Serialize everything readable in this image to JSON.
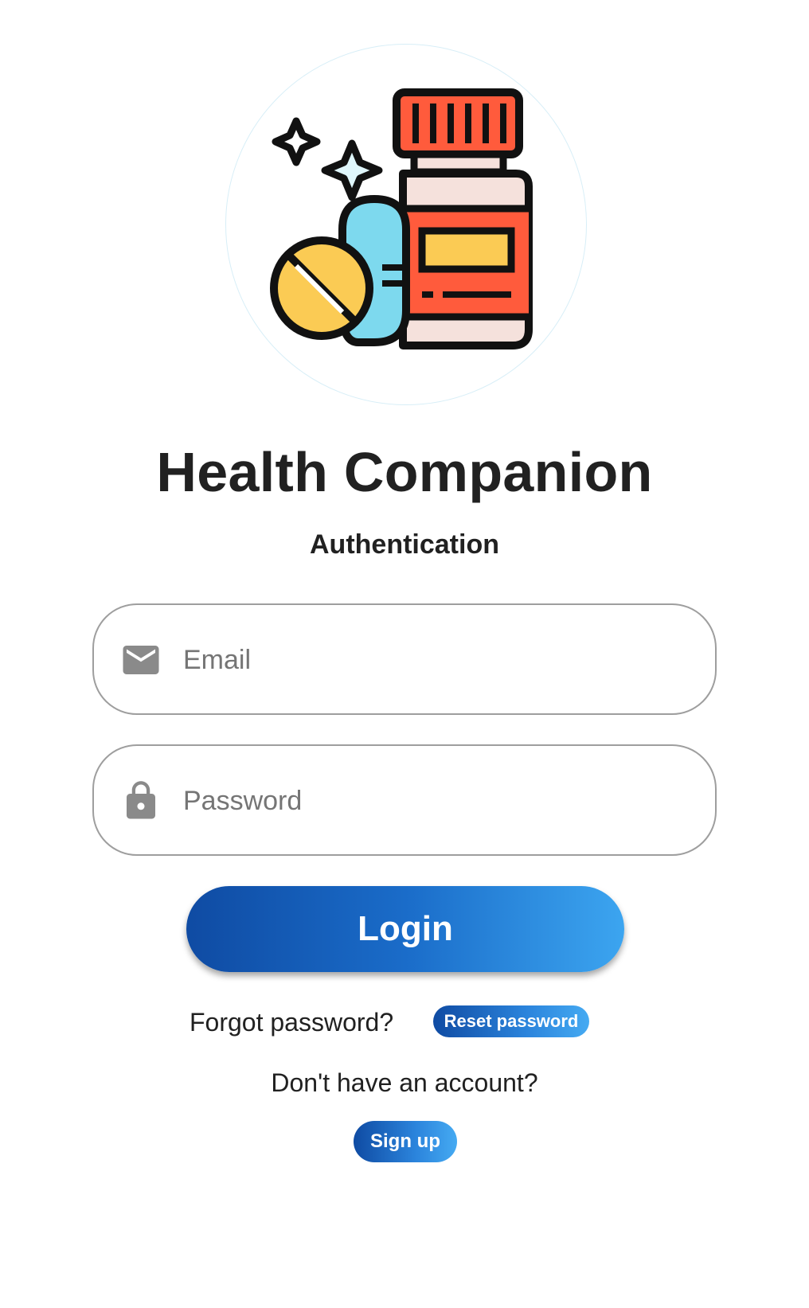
{
  "app": {
    "title": "Health Companion",
    "subtitle": "Authentication"
  },
  "logo": {
    "icon": "medicine-bottle-pills-icon"
  },
  "form": {
    "email": {
      "placeholder": "Email",
      "value": "",
      "icon": "email-icon"
    },
    "password": {
      "placeholder": "Password",
      "value": "",
      "icon": "lock-icon"
    },
    "login_label": "Login"
  },
  "links": {
    "forgot_text": "Forgot password?",
    "reset_label": "Reset password",
    "no_account_text": "Don't have an account?",
    "signup_label": "Sign up"
  },
  "colors": {
    "primary_dark": "#0f4ba3",
    "primary_light": "#3ca5f0",
    "field_border": "#9e9e9e",
    "icon_gray": "#8a8a8a",
    "text": "#212121"
  }
}
